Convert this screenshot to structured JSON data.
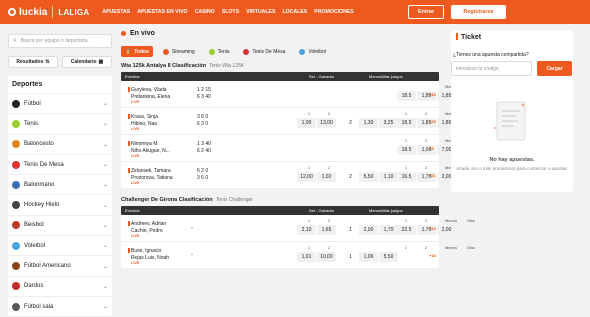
{
  "header": {
    "logo": "luckia",
    "partner": "LALIGA",
    "nav": [
      "APUESTAS",
      "APUESTAS EN VIVO",
      "CASINO",
      "SLOTS",
      "VIRTUALES",
      "LOCALES",
      "PROMOCIONES"
    ],
    "login_label": "Entrar",
    "register_label": "Registrarse",
    "accent_color": "#ee5a1e"
  },
  "sidebar": {
    "search_placeholder": "Busca por equipo o deportista..",
    "results_label": "Resultados",
    "calendar_label": "Calendario",
    "sports_title": "Deportes",
    "sports": [
      {
        "label": "Fútbol",
        "icon": "soccer-ball-icon"
      },
      {
        "label": "Tenis",
        "icon": "tennis-ball-icon"
      },
      {
        "label": "Baloncesto",
        "icon": "basketball-icon"
      },
      {
        "label": "Tenis De Mesa",
        "icon": "table-tennis-icon"
      },
      {
        "label": "Balonmano",
        "icon": "handball-icon"
      },
      {
        "label": "Hockey Hielo",
        "icon": "ice-hockey-icon"
      },
      {
        "label": "Beisbol",
        "icon": "baseball-icon"
      },
      {
        "label": "Voleibol",
        "icon": "volleyball-icon"
      },
      {
        "label": "Fútbol Americano",
        "icon": "american-football-icon"
      },
      {
        "label": "Dardos",
        "icon": "darts-icon"
      },
      {
        "label": "Fútbol sala",
        "icon": "futsal-icon"
      }
    ]
  },
  "main": {
    "title": "En vivo",
    "filters": [
      "Todos",
      "Streaming",
      "Tenis",
      "Tenis De Mesa",
      "Voleibol"
    ],
    "sections": [
      {
        "league": "Wta 125k Antalya II Clasificación",
        "sub": "Tenis Wta 125K",
        "col_events": "Eventos",
        "col_winner": "Set - Ganador",
        "col_games": "Menos/Más juegos",
        "matches": [
          {
            "p1": "Guryleva, Vlada",
            "p2": "Pridankina, Elena",
            "s1": "1  2  15",
            "s2": "6  3  40",
            "hdrs": [
              "",
              "",
              "",
              "",
              "Menos",
              "Más"
            ],
            "odds": [
              "",
              "",
              "",
              "18.5",
              "1,80",
              "1,85"
            ],
            "more": "+19"
          },
          {
            "p1": "Kraus, Sinja",
            "p2": "Hibino, Nao",
            "s1": "3  6  0",
            "s2": "6  3  0",
            "hdrs": [
              "1",
              "2",
              "1",
              "2",
              "Menos",
              "Más"
            ],
            "odds": [
              "1,00",
              "13,00",
              "2",
              "1,30",
              "3,25",
              "18.5",
              "1,85",
              "1,80"
            ],
            "more": "+25"
          },
          {
            "p1": "Ninomiya M.",
            "p2": "Niho Akugue, N...",
            "s1": "1  3  40",
            "s2": "6  2  40",
            "hdrs": [
              "",
              "",
              "1",
              "2",
              "Menos",
              "Más"
            ],
            "odds": [
              "",
              "",
              "",
              "",
              "",
              "18.5",
              "1,06",
              "7,00"
            ],
            "more": "+8"
          },
          {
            "p1": "Zidansek, Tamara",
            "p2": "Prozorova, Tatiana",
            "s1": "6  2  0",
            "s2": "3  6  0",
            "hdrs": [
              "1",
              "2",
              "1",
              "2",
              "Menos",
              "Más"
            ],
            "odds": [
              "12,00",
              "1,02",
              "2",
              "5,50",
              "1,10",
              "16.5",
              "1,70",
              "2,00"
            ],
            "more": "+21"
          }
        ]
      },
      {
        "league": "Challenger De Girona Clasificación",
        "sub": "Tenis Challenger",
        "col_events": "Eventos",
        "col_winner": "Set - Ganador",
        "col_games": "Menos/Más juegos",
        "matches": [
          {
            "p1": "Andreev, Adrian",
            "p2": "Cachin, Pedro",
            "s1": "-",
            "s2": "",
            "hdrs": [
              "1",
              "2",
              "1",
              "2",
              "Menos",
              "Más"
            ],
            "odds": [
              "2,10",
              "1,65",
              "1",
              "2,00",
              "1,70",
              "22.5",
              "1,70",
              "2,00"
            ],
            "more": "+13"
          },
          {
            "p1": "Buse, Ignacio",
            "p2": "Rejas Luis, Noah",
            "s1": "-",
            "s2": "",
            "hdrs": [
              "1",
              "2",
              "1",
              "2",
              "Menos",
              "Más"
            ],
            "odds": [
              "1,01",
              "10,00",
              "1",
              "1,06",
              "5,50",
              "",
              "",
              ""
            ],
            "more": "+18"
          }
        ]
      }
    ]
  },
  "ticket": {
    "title": "Ticket",
    "question": "¿Tienes una apuesta compartida?",
    "code_placeholder": "Introduce tu código",
    "load_label": "Cargar",
    "empty_title": "No hay apuestas.",
    "empty_text": "Añade uno o más pronósticos para comenzar a apostar."
  }
}
